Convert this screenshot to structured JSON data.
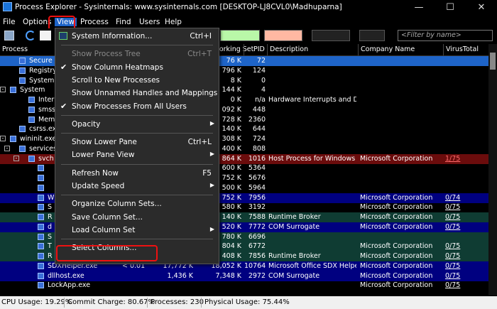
{
  "window": {
    "title": "Process Explorer - Sysinternals: www.sysinternals.com [DESKTOP-LJ8CVL0\\Madhuparna]",
    "minimize_glyph": "—",
    "maximize_glyph": "☐",
    "close_glyph": "✕"
  },
  "menubar": [
    "File",
    "Options",
    "View",
    "Process",
    "Find",
    "Users",
    "Help"
  ],
  "toolbar": {
    "filter_placeholder": "<Filter by name>"
  },
  "columns": [
    "Process",
    "Working Set",
    "PID",
    "Description",
    "Company Name",
    "VirusTotal"
  ],
  "processes": [
    {
      "name": "Secure Sys",
      "ws": "76 K",
      "pid": "72",
      "desc": "",
      "company": "",
      "vt": "",
      "indent": 1,
      "selected": true
    },
    {
      "name": "Registry",
      "ws": "796 K",
      "pid": "124",
      "desc": "",
      "company": "",
      "vt": "",
      "indent": 1
    },
    {
      "name": "System Idle",
      "ws": "8 K",
      "pid": "0",
      "desc": "",
      "company": "",
      "vt": "",
      "indent": 1
    },
    {
      "name": "System",
      "ws": "144 K",
      "pid": "4",
      "desc": "",
      "company": "",
      "vt": "",
      "indent": 0,
      "expander": "-"
    },
    {
      "name": "Interrupt",
      "ws": "0 K",
      "pid": "n/a",
      "desc": "Hardware Interrupts and DPCs",
      "company": "",
      "vt": "",
      "indent": 2
    },
    {
      "name": "smss.exe",
      "ws": "092 K",
      "pid": "448",
      "desc": "",
      "company": "",
      "vt": "",
      "indent": 2
    },
    {
      "name": "Memory",
      "ws": "728 K",
      "pid": "2360",
      "desc": "",
      "company": "",
      "vt": "",
      "indent": 2
    },
    {
      "name": "csrss.exe",
      "ws": "140 K",
      "pid": "644",
      "desc": "",
      "company": "",
      "vt": "",
      "indent": 1
    },
    {
      "name": "wininit.exe",
      "ws": "308 K",
      "pid": "724",
      "desc": "",
      "company": "",
      "vt": "",
      "indent": 0,
      "expander": "-"
    },
    {
      "name": "services",
      "ws": "400 K",
      "pid": "808",
      "desc": "",
      "company": "",
      "vt": "",
      "indent": 1,
      "expander": "-"
    },
    {
      "name": "svch",
      "ws": "864 K",
      "pid": "1016",
      "desc": "Host Process for Windows S...",
      "company": "Microsoft Corporation",
      "vt": "1/75",
      "indent": 2,
      "expander": "-",
      "bg": "#6b0c0c"
    },
    {
      "name": "",
      "ws": "600 K",
      "pid": "5364",
      "desc": "",
      "company": "",
      "vt": "",
      "indent": 3
    },
    {
      "name": "",
      "ws": "752 K",
      "pid": "5676",
      "desc": "",
      "company": "",
      "vt": "",
      "indent": 3
    },
    {
      "name": "",
      "ws": "500 K",
      "pid": "5964",
      "desc": "",
      "company": "",
      "vt": "",
      "indent": 3
    },
    {
      "name": "W",
      "ws": "752 K",
      "pid": "7956",
      "desc": "",
      "company": "Microsoft Corporation",
      "vt": "0/74",
      "indent": 3,
      "bg": "#000080"
    },
    {
      "name": "S",
      "ws": "580 K",
      "pid": "3192",
      "desc": "",
      "company": "Microsoft Corporation",
      "vt": "0/75",
      "indent": 3
    },
    {
      "name": "R",
      "ws": "140 K",
      "pid": "7588",
      "desc": "Runtime Broker",
      "company": "Microsoft Corporation",
      "vt": "0/75",
      "indent": 3,
      "bg": "#0f3c33"
    },
    {
      "name": "d",
      "ws": "520 K",
      "pid": "7772",
      "desc": "COM Surrogate",
      "company": "Microsoft Corporation",
      "vt": "0/75",
      "indent": 3,
      "bg": "#000080"
    },
    {
      "name": "S",
      "ws": "780 K",
      "pid": "6696",
      "desc": "",
      "company": "",
      "vt": "",
      "indent": 3,
      "bg": "#0f3c33"
    },
    {
      "name": "T",
      "ws": "804 K",
      "pid": "6772",
      "desc": "",
      "company": "Microsoft Corporation",
      "vt": "0/75",
      "indent": 3,
      "bg": "#0f3c33"
    },
    {
      "name": "R",
      "ws": "408 K",
      "pid": "7856",
      "desc": "Runtime Broker",
      "company": "Microsoft Corporation",
      "vt": "0/75",
      "indent": 3,
      "bg": "#0f3c33"
    },
    {
      "name": "SDXHelper.exe",
      "cpu": "< 0.01",
      "pb": "17,772 K",
      "ws": "18,052 K",
      "pid": "10764",
      "desc": "Microsoft Office SDX Helper",
      "company": "Microsoft Corporation",
      "vt": "0/75",
      "indent": 3,
      "bg": "#000080"
    },
    {
      "name": "dllhost.exe",
      "cpu": "",
      "pb": "1,436 K",
      "ws": "7,348 K",
      "pid": "2972",
      "desc": "COM Surrogate",
      "company": "Microsoft Corporation",
      "vt": "0/75",
      "indent": 3,
      "bg": "#000080"
    },
    {
      "name": "LockApp.exe",
      "cpu": "",
      "pb": "",
      "ws": "",
      "pid": "",
      "desc": "",
      "company": "Microsoft Corporation",
      "vt": "0/75",
      "indent": 3
    }
  ],
  "view_menu": [
    {
      "label": "System Information...",
      "shortcut": "Ctrl+I",
      "icon": true
    },
    {
      "sep": true
    },
    {
      "label": "Show Process Tree",
      "shortcut": "Ctrl+T",
      "disabled": true
    },
    {
      "label": "Show Column Heatmaps",
      "checked": true
    },
    {
      "label": "Scroll to New Processes"
    },
    {
      "label": "Show Unnamed Handles and Mappings"
    },
    {
      "label": "Show Processes From All Users",
      "checked": true
    },
    {
      "sep": true
    },
    {
      "label": "Opacity",
      "submenu": true
    },
    {
      "sep": true
    },
    {
      "label": "Show Lower Pane",
      "shortcut": "Ctrl+L"
    },
    {
      "label": "Lower Pane View",
      "submenu": true
    },
    {
      "sep": true
    },
    {
      "label": "Refresh Now",
      "shortcut": "F5"
    },
    {
      "label": "Update Speed",
      "submenu": true
    },
    {
      "sep": true
    },
    {
      "label": "Organize Column Sets..."
    },
    {
      "label": "Save Column Set..."
    },
    {
      "label": "Load Column Set",
      "submenu": true
    },
    {
      "sep": true
    },
    {
      "label": "Select Columns..."
    }
  ],
  "status": {
    "cpu": "CPU Usage: 19.29%",
    "commit": "Commit Charge: 80.67%",
    "processes": "Processes: 230",
    "physical": "Physical Usage: 75.44%"
  },
  "colors": {
    "accent": "#1e64c8",
    "highlight": "#e01010",
    "service_row": "#6b0c0c",
    "ms_row": "#000080",
    "app_row": "#0f3c33"
  }
}
